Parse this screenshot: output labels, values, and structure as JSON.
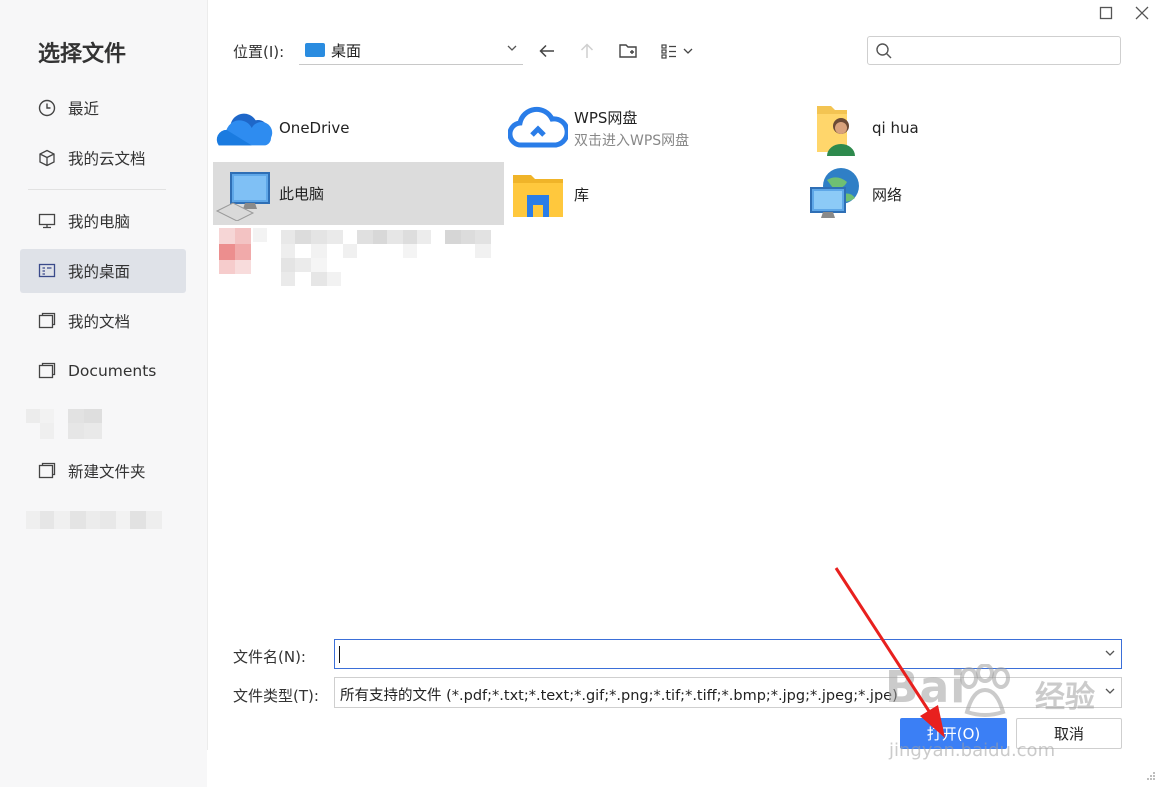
{
  "dialog": {
    "title": "选择文件",
    "controls": {
      "maximize": "☐",
      "close": "✕"
    }
  },
  "sidebar": {
    "items": [
      {
        "label": "最近",
        "icon": "clock-icon"
      },
      {
        "label": "我的云文档",
        "icon": "cube-icon"
      },
      {
        "label": "我的电脑",
        "icon": "monitor-icon"
      },
      {
        "label": "我的桌面",
        "icon": "desktop-icon",
        "active": true
      },
      {
        "label": "我的文档",
        "icon": "folder-icon"
      },
      {
        "label": "Documents",
        "icon": "folder-icon"
      },
      {
        "label": "新建文件夹",
        "icon": "folder-icon"
      }
    ]
  },
  "toolbar": {
    "location_label": "位置(I):",
    "location_value": "桌面",
    "icons": [
      "back-arrow-icon",
      "up-arrow-icon",
      "new-folder-icon",
      "view-mode-icon"
    ],
    "search_placeholder": ""
  },
  "items": [
    {
      "name": "OneDrive",
      "sub": "",
      "icon": "onedrive-cloud-icon"
    },
    {
      "name": "WPS网盘",
      "sub": "双击进入WPS网盘",
      "icon": "wps-cloud-icon"
    },
    {
      "name": "qi hua",
      "sub": "",
      "icon": "user-folder-icon"
    },
    {
      "name": "此电脑",
      "sub": "",
      "icon": "computer-icon",
      "selected": true
    },
    {
      "name": "库",
      "sub": "",
      "icon": "library-folder-icon"
    },
    {
      "name": "网络",
      "sub": "",
      "icon": "network-icon"
    }
  ],
  "form": {
    "filename_label": "文件名(N):",
    "filename_value": "",
    "filetype_label": "文件类型(T):",
    "filetype_value": "所有支持的文件 (*.pdf;*.txt;*.text;*.gif;*.png;*.tif;*.tiff;*.bmp;*.jpg;*.jpeg;*.jpe)",
    "open_button": "打开(O)",
    "cancel_button": "取消"
  },
  "watermark": {
    "brand": "Bai",
    "brand_cn": "经验",
    "url": "jingyan.baidu.com"
  },
  "colors": {
    "accent": "#3b7ff5",
    "sidebar_bg": "#f7f7f8",
    "active_item": "#dfe2e8",
    "arrow": "#e8201e"
  }
}
